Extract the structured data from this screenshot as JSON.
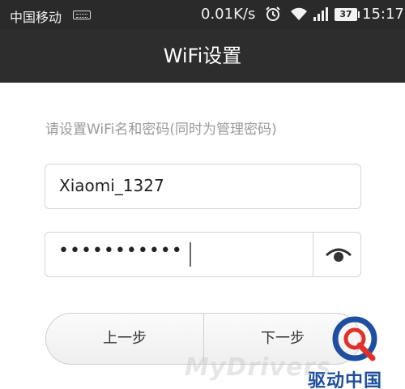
{
  "status_bar": {
    "carrier": "中国移动",
    "speed": "0.01K/s",
    "battery": "37",
    "time": "15:17",
    "icons": [
      "keyboard-icon",
      "alarm-icon",
      "wifi-icon",
      "signal-icon",
      "battery-icon"
    ]
  },
  "header": {
    "title": "WiFi设置"
  },
  "form": {
    "instruction": "请设置WiFi名和密码(同时为管理密码)",
    "ssid_value": "Xiaomi_1327",
    "password_masked": "•••••••••••",
    "show_password_icon": "eye-icon"
  },
  "buttons": {
    "prev_label": "上一步",
    "next_label": "下一步"
  },
  "watermark": {
    "text": "MyDrivers",
    "logo_text": "驱动中国",
    "logo_icon": "q-logo-icon"
  },
  "colors": {
    "status_bar_bg": "#2a2a2a",
    "title_bar_bg": "#2d2d2d",
    "instruction_text": "#9a9a9a",
    "field_border": "#d4d4d4",
    "logo_blue": "#1f4fa0",
    "logo_red": "#e0322b"
  }
}
